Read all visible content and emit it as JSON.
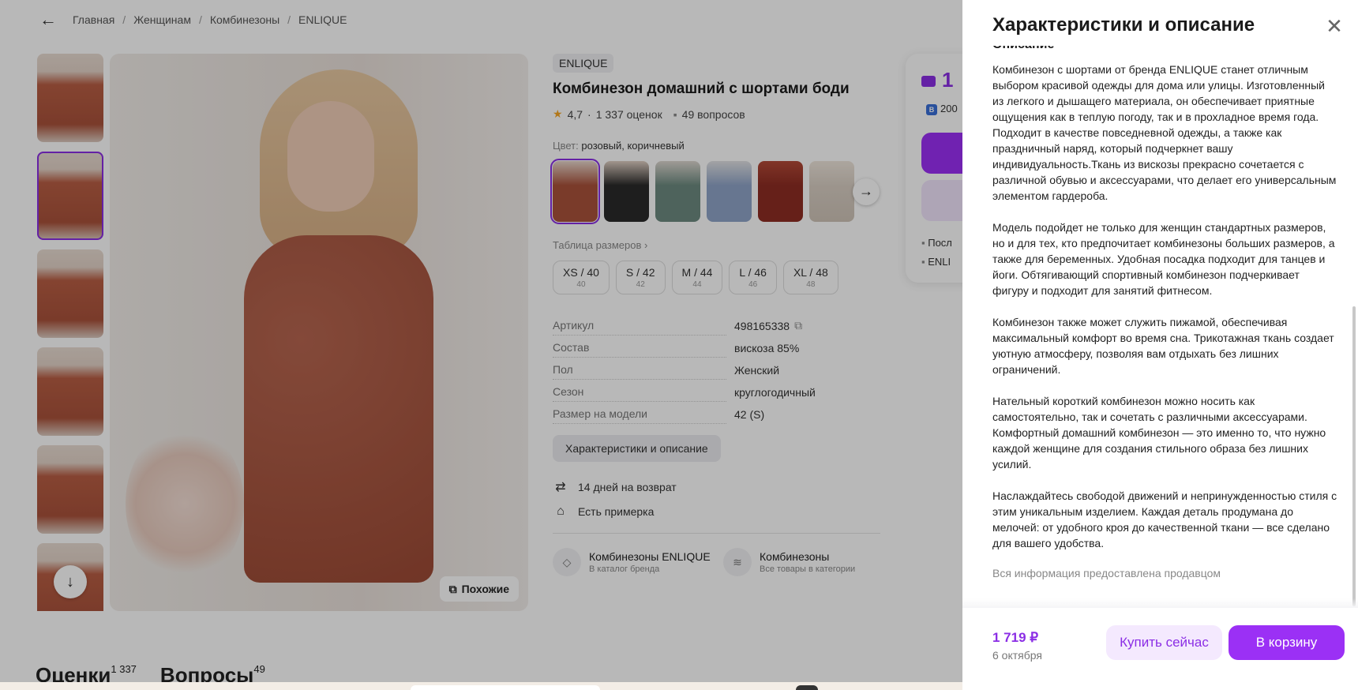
{
  "breadcrumbs": [
    "Главная",
    "Женщинам",
    "Комбинезоны",
    "ENLIQUE"
  ],
  "product": {
    "brand": "ENLIQUE",
    "title": "Комбинезон домашний с шортами боди",
    "rating": "4,7",
    "reviews": "1 337 оценок",
    "questions": "49 вопросов",
    "color_label": "Цвет:",
    "color_value": "розовый, коричневый",
    "size_table": "Таблица размеров",
    "sizes": [
      {
        "name": "XS / 40",
        "num": "40"
      },
      {
        "name": "S / 42",
        "num": "42"
      },
      {
        "name": "M / 44",
        "num": "44"
      },
      {
        "name": "L / 46",
        "num": "46"
      },
      {
        "name": "XL / 48",
        "num": "48"
      }
    ],
    "specs": [
      {
        "k": "Артикул",
        "v": "498165338"
      },
      {
        "k": "Состав",
        "v": "вискоза 85%"
      },
      {
        "k": "Пол",
        "v": "Женский"
      },
      {
        "k": "Сезон",
        "v": "круглогодичный"
      },
      {
        "k": "Размер на модели",
        "v": "42 (S)"
      }
    ],
    "specs_button": "Характеристики и описание",
    "return_text": "14 дней на возврат",
    "fitting_text": "Есть примерка",
    "similar_button": "Похожие",
    "brand_link": {
      "title": "Комбинезоны ENLIQUE",
      "sub": "В каталог бренда"
    },
    "category_link": {
      "title": "Комбинезоны",
      "sub": "Все товары в категории"
    }
  },
  "buy_card": {
    "price": "1",
    "bonus": "200",
    "line1": "Посл",
    "line2": "ENLI"
  },
  "bottom_tabs": [
    {
      "label": "Оценки",
      "count": "1 337"
    },
    {
      "label": "Вопросы",
      "count": "49"
    }
  ],
  "panel": {
    "title": "Характеристики и описание",
    "section_heading": "Описание",
    "paragraphs": [
      "Комбинезон с шортами от бренда ENLIQUE станет отличным выбором красивой одежды для дома или улицы. Изготовленный из легкого и дышащего материала, он обеспечивает приятные ощущения как в теплую погоду, так и в прохладное время года. Подходит в качестве повседневной одежды, а также как праздничный наряд, который подчеркнет вашу индивидуальность.Ткань из вискозы прекрасно сочетается с различной обувью и аксессуарами, что делает его универсальным элементом гардероба.",
      "Модель подойдет не только для женщин стандартных размеров, но и для тех, кто предпочитает комбинезоны больших размеров, а также для беременных. Удобная посадка подходит для танцев и йоги. Обтягивающий спортивный комбинезон подчеркивает фигуру и подходит для занятий фитнесом.",
      "Комбинезон также может служить пижамой, обеспечивая максимальный комфорт во время сна. Трикотажная ткань создает уютную атмосферу, позволяя вам отдыхать без лишних ограничений.",
      "Нательный короткий комбинезон можно носить как самостоятельно, так и сочетать с различными аксессуарами. Комфортный домашний комбинезон — это именно то, что нужно каждой женщине для создания стильного образа без лишних усилий.",
      "Наслаждайтесь свободой движений и непринужденностью стиля с этим уникальным изделием. Каждая деталь продумана до мелочей: от удобного кроя до качественной ткани — все сделано для вашего удобства."
    ],
    "seller_note": "Вся информация предоставлена продавцом",
    "footer": {
      "price": "1 719 ₽",
      "date": "6 октября",
      "buy_now": "Купить сейчас",
      "add_to_cart": "В корзину"
    }
  },
  "colors": {
    "accent": "#8b2ee5",
    "button": "#9b30f5",
    "dress": "#a9523b"
  }
}
